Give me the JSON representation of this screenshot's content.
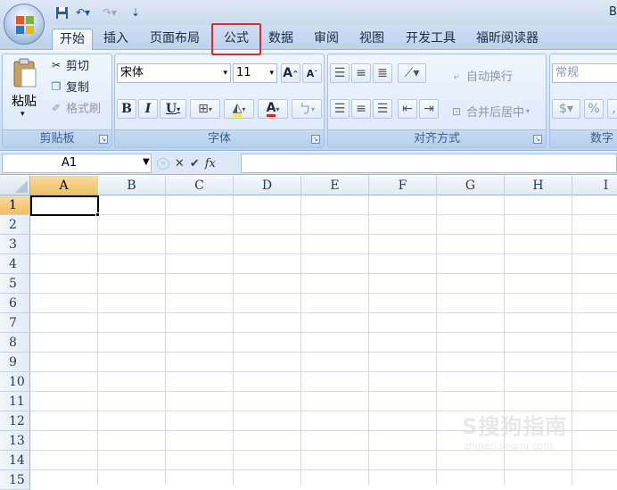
{
  "window": {
    "title_partial": "B"
  },
  "tabs": [
    {
      "label": "开始",
      "active": true
    },
    {
      "label": "插入"
    },
    {
      "label": "页面布局"
    },
    {
      "label": "公式",
      "highlighted": true
    },
    {
      "label": "数据"
    },
    {
      "label": "审阅"
    },
    {
      "label": "视图"
    },
    {
      "label": "开发工具"
    },
    {
      "label": "福昕阅读器"
    }
  ],
  "clipboard": {
    "paste": "粘贴",
    "cut": "剪切",
    "copy": "复制",
    "format_painter": "格式刷",
    "group_label": "剪贴板"
  },
  "font": {
    "name": "宋体",
    "size": "11",
    "grow": "A",
    "shrink": "A",
    "bold": "B",
    "italic": "I",
    "underline": "U",
    "color_a": "A",
    "group_label": "字体"
  },
  "alignment": {
    "wrap_text": "自动换行",
    "merge_center": "合并后居中",
    "group_label": "对齐方式"
  },
  "number": {
    "format": "常规",
    "percent": "%",
    "group_label": "数字"
  },
  "formula_bar": {
    "name_box": "A1",
    "cancel": "✕",
    "enter": "✔",
    "fx": "fx",
    "content": ""
  },
  "columns": [
    "A",
    "B",
    "C",
    "D",
    "E",
    "F",
    "G",
    "H",
    "I"
  ],
  "rows": [
    "1",
    "2",
    "3",
    "4",
    "5",
    "6",
    "7",
    "8",
    "9",
    "10",
    "11",
    "12",
    "13",
    "14",
    "15"
  ],
  "selected_cell": "A1",
  "watermark": {
    "brand": "S搜狗指南",
    "url": "zhinan.sogou.com"
  },
  "colors": {
    "highlight": "#e02b2b",
    "ribbon": "#cfe0f4",
    "selection_header": "#f1c15f"
  }
}
